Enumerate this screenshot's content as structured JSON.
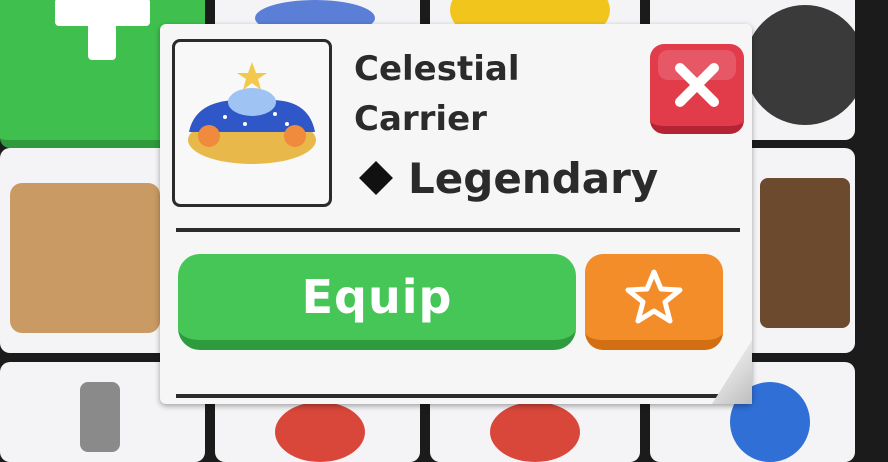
{
  "item": {
    "name_line1": "Celestial",
    "name_line2": "Carrier",
    "rarity": "Legendary"
  },
  "actions": {
    "equip_label": "Equip"
  },
  "icons": {
    "close": "close-icon",
    "favorite": "star-icon",
    "rarity": "diamond-icon"
  },
  "colors": {
    "equip": "#46c657",
    "close": "#e23b4a",
    "favorite": "#f28d2a",
    "add_tile": "#3fbf4e"
  }
}
